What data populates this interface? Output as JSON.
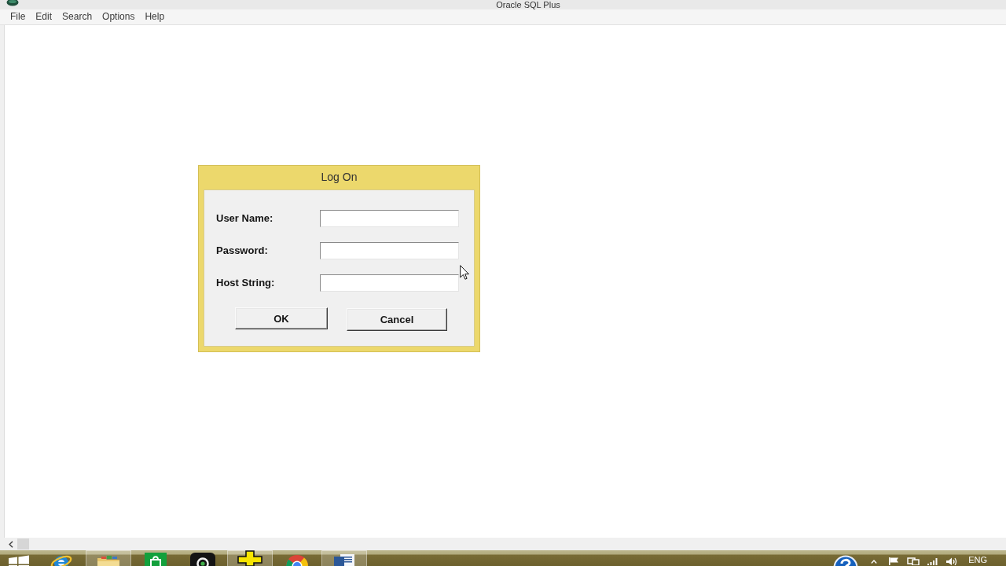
{
  "window": {
    "title": "Oracle SQL Plus"
  },
  "menu": [
    {
      "label": "File"
    },
    {
      "label": "Edit"
    },
    {
      "label": "Search"
    },
    {
      "label": "Options"
    },
    {
      "label": "Help"
    }
  ],
  "dialog": {
    "title": "Log On",
    "fields": [
      {
        "label": "User Name:"
      },
      {
        "label": "Password:"
      },
      {
        "label": "Host String:"
      }
    ],
    "buttons": [
      {
        "label": "OK"
      },
      {
        "label": "Cancel"
      }
    ]
  },
  "taskbar": {
    "apps": [
      {
        "kind": "start",
        "running": false
      },
      {
        "kind": "ie",
        "running": false
      },
      {
        "kind": "folder",
        "running": true
      },
      {
        "kind": "store",
        "running": false
      },
      {
        "kind": "camera",
        "running": false
      },
      {
        "kind": "plus",
        "running": true
      },
      {
        "kind": "chrome",
        "running": false
      },
      {
        "kind": "word",
        "running": true
      }
    ],
    "language": "ENG"
  }
}
